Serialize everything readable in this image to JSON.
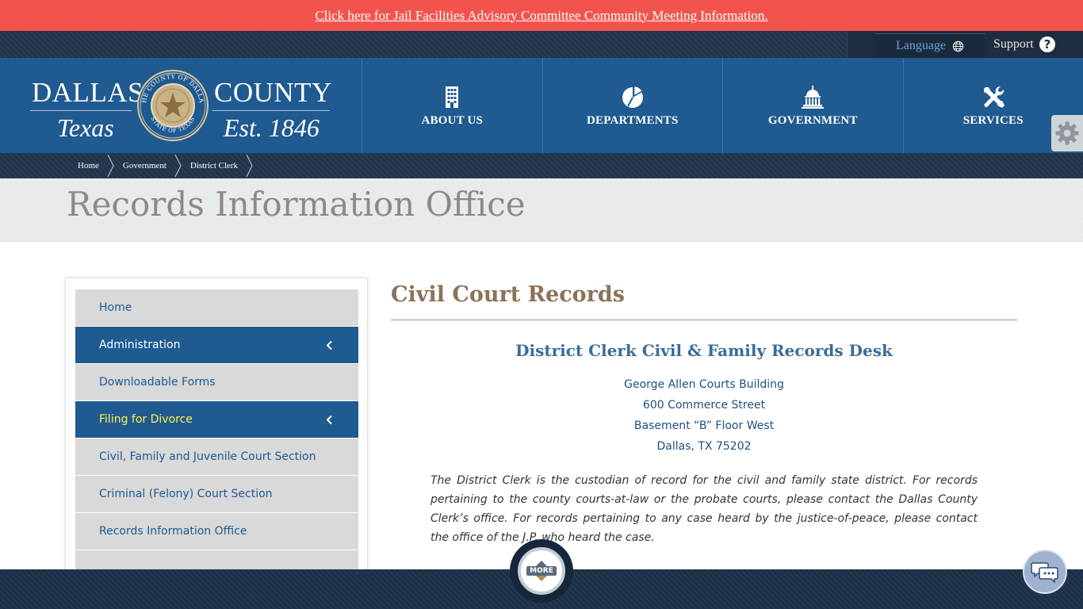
{
  "alert": {
    "link_text": "Click here for Jail Facilities Advisory Committee Community Meeting Information."
  },
  "utility": {
    "language_label": "Language",
    "support_label": "Support"
  },
  "logo": {
    "word1": "DALLAS",
    "word2": "COUNTY",
    "word3": "Texas",
    "word4": "Est. 1846",
    "seal_top": "THE COUNTY OF DALLAS",
    "seal_bottom": "STATE OF TEXAS"
  },
  "nav": {
    "items": [
      {
        "label": "ABOUT US",
        "icon": "building-icon"
      },
      {
        "label": "DEPARTMENTS",
        "icon": "pie-chart-icon"
      },
      {
        "label": "GOVERNMENT",
        "icon": "capitol-icon"
      },
      {
        "label": "SERVICES",
        "icon": "tools-icon"
      }
    ]
  },
  "breadcrumb": [
    "Home",
    "Government",
    "District Clerk"
  ],
  "page_title": "Records Information Office",
  "sidebar": {
    "items": [
      {
        "label": "Home",
        "active": false
      },
      {
        "label": "Administration",
        "active": true
      },
      {
        "label": "Downloadable Forms",
        "active": false
      },
      {
        "label": "Filing for Divorce",
        "active": true
      },
      {
        "label": "Civil, Family and Juvenile Court Section",
        "active": false
      },
      {
        "label": "Criminal (Felony) Court Section",
        "active": false
      },
      {
        "label": "Records Information Office",
        "active": false
      }
    ]
  },
  "main": {
    "heading": "Civil Court Records",
    "subheading": "District Clerk Civil & Family Records Desk",
    "address": [
      "George Allen Courts Building",
      "600 Commerce Street",
      "Basement “B” Floor West",
      "Dallas, TX 75202"
    ],
    "paragraph": "The District Clerk is the custodian of record for the civil and family state district. For records pertaining to the county courts-at-law or the probate courts, please contact the Dallas County Clerk’s office. For records pertaining to any case heard by the justice-of-peace, please contact the office of the J.P. who heard the case."
  },
  "footer": {
    "more_label": "MORE"
  },
  "colors": {
    "alert": "#f2544d",
    "header": "#1f5a91",
    "accent_yellow": "#fff34d",
    "heading_brown": "#8b7258"
  }
}
